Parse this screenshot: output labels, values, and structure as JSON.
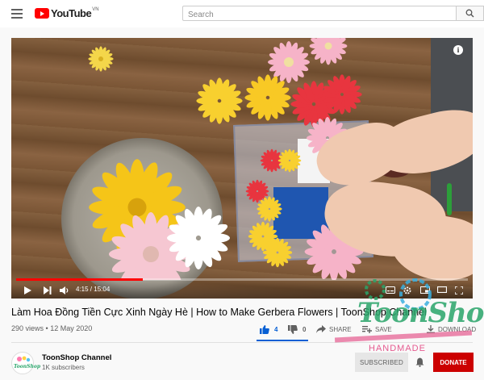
{
  "header": {
    "logo_text": "YouTube",
    "country_code": "VN",
    "search_placeholder": "Search"
  },
  "player": {
    "time_current": "4:15",
    "time_separator": " / ",
    "time_total": "15:04",
    "progress": 0.28
  },
  "video": {
    "title": "Làm Hoa Đồng Tiền Cực Xinh Ngày Hè | How to Make Gerbera Flowers | ToonShop Channel",
    "views": "290 views",
    "date_separator": " • ",
    "date": "12 May 2020",
    "likes": "4",
    "dislikes": "0",
    "share_label": "SHARE",
    "save_label": "SAVE",
    "download_label": "DOWNLOAD"
  },
  "channel": {
    "name": "ToonShop Channel",
    "subscribers": "1K subscribers",
    "subscribe_label": "SUBSCRIBED",
    "donate_label": "DONATE",
    "avatar_text": "ToonShop"
  },
  "watermark": {
    "brand": "ToonShop",
    "tagline": "HANDMADE"
  },
  "colors": {
    "brand_red": "#ff0000",
    "like_blue": "#065fd4",
    "donate_red": "#cc0000",
    "watermark_green": "#2aa56a",
    "watermark_pink": "#e55a8f"
  }
}
